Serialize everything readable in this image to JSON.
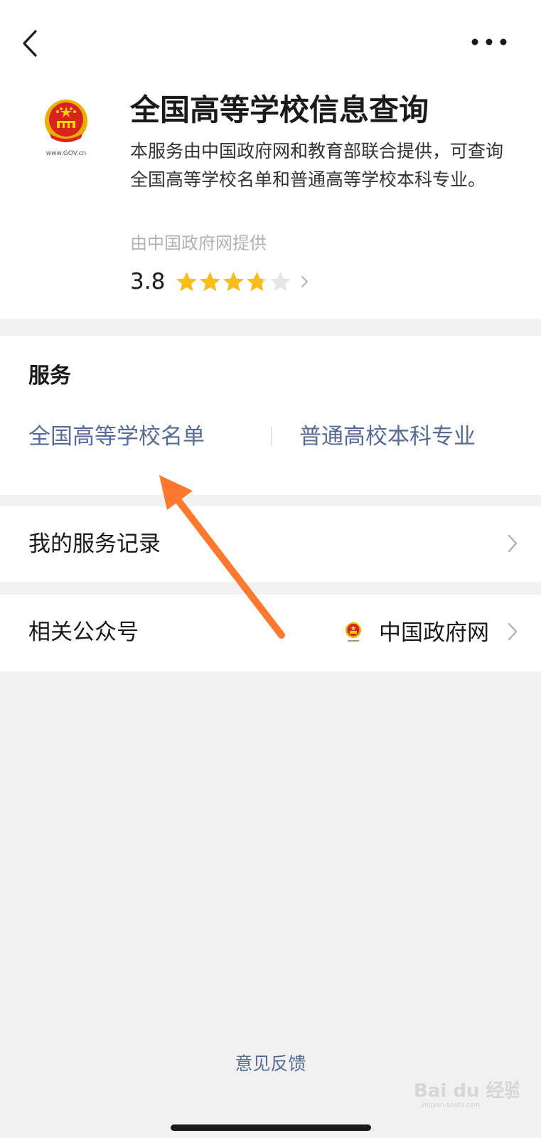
{
  "app": {
    "title": "全国高等学校信息查询",
    "description": "本服务由中国政府网和教育部联合提供，可查询全国高等学校名单和普通高等学校本科专业。",
    "provider": "由中国政府网提供",
    "logo_text": "www.GOV.cn",
    "rating": {
      "value": "3.8",
      "score": 3.8,
      "max": 5
    }
  },
  "icons": {
    "back": "back-chevron-icon",
    "more": "more-dots-icon",
    "star": "star-icon",
    "chevron": "chevron-right-icon"
  },
  "services": {
    "title": "服务",
    "items": [
      {
        "label": "全国高等学校名单"
      },
      {
        "label": "普通高校本科专业"
      }
    ]
  },
  "records": {
    "label": "我的服务记录"
  },
  "related": {
    "label": "相关公众号",
    "account_name": "中国政府网"
  },
  "footer": {
    "feedback": "意见反馈"
  },
  "watermark": {
    "text": "Bai du 经验",
    "sub": "jingyan.baidu.com"
  },
  "colors": {
    "link": "#576b95",
    "star_filled": "#f7bd19",
    "star_empty": "#e6e6e6",
    "background": "#f1f1f1",
    "annotation_arrow": "#ff7a2e"
  }
}
